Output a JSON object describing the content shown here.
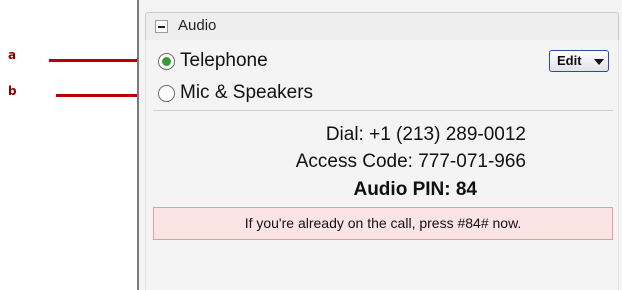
{
  "callouts": {
    "a": "a",
    "b": "b"
  },
  "panel": {
    "title": "Audio",
    "options": [
      {
        "label": "Telephone",
        "selected": true
      },
      {
        "label": "Mic & Speakers",
        "selected": false
      }
    ],
    "edit_label": "Edit",
    "dial": "Dial: +1 (213) 289-0012",
    "access_code": "Access Code: 777-071-966",
    "pin": "Audio PIN: 84",
    "notice": "If you're already on the call, press #84# now."
  },
  "colors": {
    "callout": "#b40000",
    "radio_selected": "#3a9a3a",
    "notice_bg": "#fde4e4",
    "notice_border": "#ee9a9a",
    "edit_border": "#2d4a9c"
  },
  "icons": {
    "collapse": "minus-icon",
    "edit_caret": "caret-down-icon"
  }
}
